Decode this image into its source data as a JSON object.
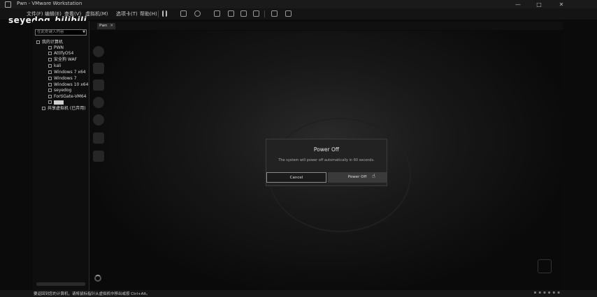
{
  "window": {
    "title": "Pwn - VMware Workstation",
    "controls": [
      "—",
      "□",
      "✕"
    ]
  },
  "menu": {
    "items": [
      "文件(F)",
      "编辑(E)",
      "查看(V)",
      "虚拟机(M)",
      "选项卡(T)",
      "帮助(H)"
    ],
    "toolbar_icons": [
      "pause-icon",
      "send-keys-icon",
      "snapshot-icon",
      "revert-icon",
      "manage-snapshots-icon",
      "fullscreen-icon",
      "unity-icon",
      "console-icon",
      "stretch-icon"
    ]
  },
  "watermark": {
    "user": "seyedog",
    "brand": "bilibili"
  },
  "sidebar": {
    "search_placeholder": "在此处键入内容",
    "root": "我的计算机",
    "vms": [
      "PWN",
      "AttifyOS4",
      "安全狗 WAF",
      "kali",
      "Windows 7 x64",
      "Windows 7",
      "Windows 10 x64",
      "seyedog",
      "FortiGate-VM64"
    ],
    "shared": "共享虚拟机 (已弃用)"
  },
  "tab": {
    "label": "Pwn",
    "close": "✕"
  },
  "dialog": {
    "title": "Power Off",
    "message": "The system will power off automatically in 60 seconds.",
    "cancel": "Cancel",
    "power_off": "Power Off"
  },
  "status": {
    "text": "要返回到您的计算机，请将鼠标指针从虚拟机中移出或按 Ctrl+Alt。"
  }
}
